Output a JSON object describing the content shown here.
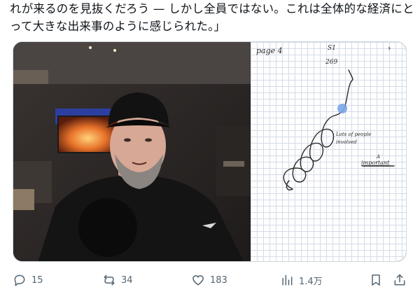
{
  "tweet": {
    "lines": [
      "れが来るのを見抜くだろう — しかし全員ではない。これは全体的な経済にと",
      "って大きな出来事のように感じられた。」"
    ]
  },
  "media": {
    "notes": {
      "page_label": "page 4",
      "number_top": "S1",
      "number_mid": "269",
      "note_1": "Lots of people",
      "note_2": "involved",
      "note_3": "A",
      "note_4": "important"
    }
  },
  "actions": {
    "reply_count": "15",
    "repost_count": "34",
    "like_count": "183",
    "views_count": "1.4万"
  },
  "colors": {
    "action_gray": "#536471",
    "text": "#0f1419",
    "pen_ink": "#2b2b2b",
    "touch_dot": "#7aa7e8"
  }
}
